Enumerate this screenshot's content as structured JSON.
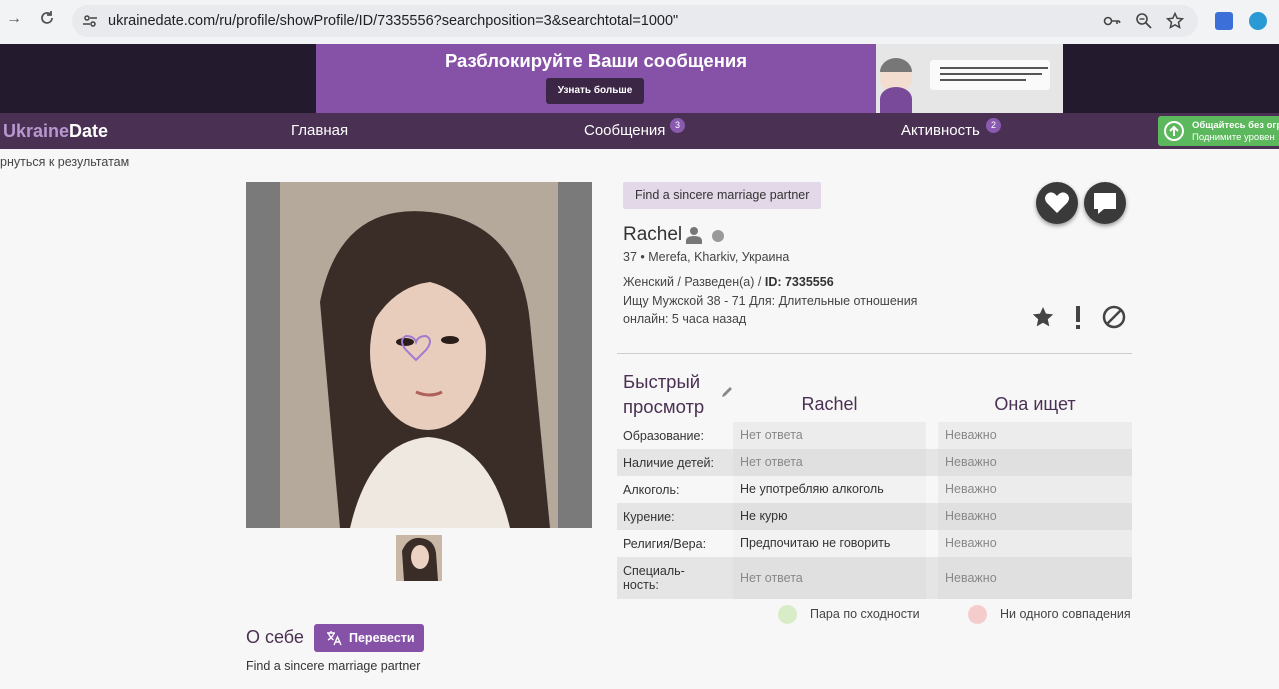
{
  "browser": {
    "url": "ukrainedate.com/ru/profile/showProfile/ID/7335556?searchposition=3&searchtotal=1000\""
  },
  "banner": {
    "title": "Разблокируйте Ваши сообщения",
    "button_label": "Узнать больше"
  },
  "nav": {
    "logo_part1": "Ukraine",
    "logo_part2": "Date",
    "items": [
      {
        "label": "Главная",
        "badge": ""
      },
      {
        "label": "Сообщения",
        "badge": "3"
      },
      {
        "label": "Активность",
        "badge": "2"
      }
    ],
    "upgrade_line1": "Общайтесь без огр",
    "upgrade_line2": "Поднимите уровен"
  },
  "back_link": "рнуться к результатам",
  "profile": {
    "tagline": "Find a sincere marriage partner",
    "name": "Rachel",
    "age_location": "37 • Merefa, Kharkiv, Украина",
    "gender_status": "Женский / Разведен(а) / ",
    "id_label": "ID: 7335556",
    "seeking": "Ищу Мужской 38 - 71 Для: Длительные отношения",
    "last_online": "онлайн: 5 часа назад"
  },
  "about": {
    "title": "О себе",
    "translate_label": "Перевести",
    "text": "Find a sincere marriage partner"
  },
  "quickview": {
    "title_line1": "Быстрый",
    "title_line2": "просмотр",
    "col1": "Rachel",
    "col2": "Она ищет",
    "rows": [
      {
        "label": "Образование:",
        "value": "Нет ответа",
        "seeking": "Неважно"
      },
      {
        "label": "Наличие детей:",
        "value": "Нет ответа",
        "seeking": "Неважно"
      },
      {
        "label": "Алкоголь:",
        "value": "Не употребляю алкоголь",
        "seeking": "Неважно"
      },
      {
        "label": "Курение:",
        "value": "Не курю",
        "seeking": "Неважно"
      },
      {
        "label": "Религия/Вера:",
        "value": "Предпочитаю не говорить",
        "seeking": "Неважно"
      },
      {
        "label_line1": "Специаль-",
        "label_line2": "ность:",
        "value": "Нет ответа",
        "seeking": "Неважно"
      }
    ],
    "legend_match": "Пара по сходности",
    "legend_nomatch": "Ни одного совпадения"
  },
  "colors": {
    "brand_purple": "#8652a8",
    "nav_bg": "#4a3052",
    "match": "#d9ecc8",
    "nomatch": "#f5cccc"
  }
}
